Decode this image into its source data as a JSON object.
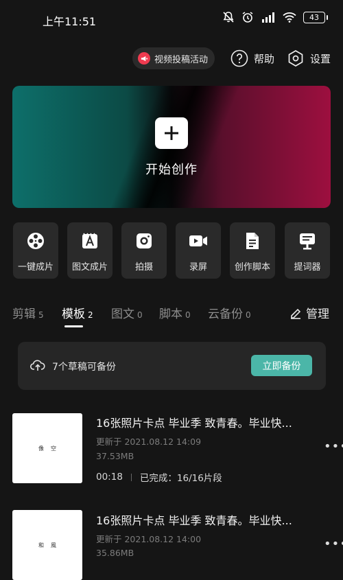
{
  "status_bar": {
    "time": "上午11:51",
    "battery": "43"
  },
  "top_actions": {
    "promo": "视频投稿活动",
    "help": "帮助",
    "settings": "设置"
  },
  "hero": {
    "label": "开始创作"
  },
  "tools": [
    {
      "label": "一键成片",
      "icon": "film-reel-icon"
    },
    {
      "label": "图文成片",
      "icon": "text-image-icon"
    },
    {
      "label": "拍摄",
      "icon": "camera-icon"
    },
    {
      "label": "录屏",
      "icon": "screen-record-icon"
    },
    {
      "label": "创作脚本",
      "icon": "script-icon"
    },
    {
      "label": "提词器",
      "icon": "teleprompter-icon"
    }
  ],
  "tabs": [
    {
      "label": "剪辑",
      "count": "5",
      "active": false
    },
    {
      "label": "模板",
      "count": "2",
      "active": true
    },
    {
      "label": "图文",
      "count": "0",
      "active": false
    },
    {
      "label": "脚本",
      "count": "0",
      "active": false
    },
    {
      "label": "云备份",
      "count": "0",
      "active": false
    }
  ],
  "manage": "管理",
  "backup": {
    "text": "7个草稿可备份",
    "button": "立即备份"
  },
  "drafts": [
    {
      "title": "16张照片卡点 毕业季 致青春。毕业快...",
      "updated": "更新于 2021.08.12 14:09",
      "size": "37.53MB",
      "duration": "00:18",
      "status": "已完成：16/16片段",
      "thumb_text": [
        "像",
        "空"
      ]
    },
    {
      "title": "16张照片卡点 毕业季 致青春。毕业快...",
      "updated": "更新于 2021.08.12 14:00",
      "size": "35.86MB",
      "thumb_text": [
        "和",
        "風"
      ]
    }
  ],
  "colors": {
    "background": "#151515",
    "card": "#2a2a2a",
    "accent": "#4bb6a8",
    "promo": "#ef3b50"
  }
}
